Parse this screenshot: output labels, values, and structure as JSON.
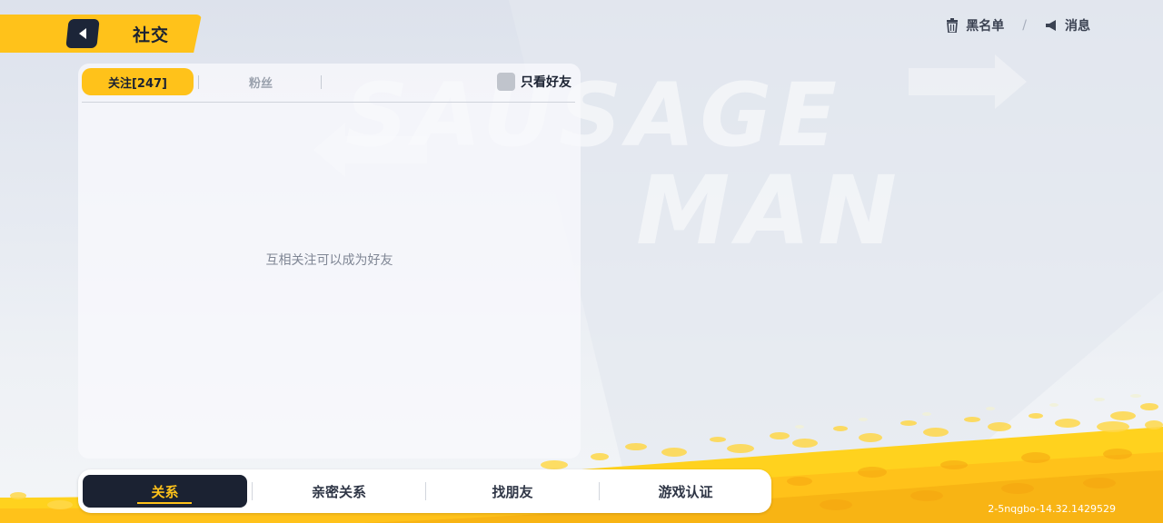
{
  "header": {
    "title": "社交",
    "blacklist_label": "黑名单",
    "separator": "/",
    "messages_label": "消息"
  },
  "tabs": {
    "follow_label": "关注[247]",
    "fans_label": "粉丝",
    "friends_only_label": "只看好友",
    "friends_only_checked": false
  },
  "panel": {
    "empty_message": "互相关注可以成为好友"
  },
  "bottom_nav": {
    "items": [
      {
        "label": "关系",
        "active": true
      },
      {
        "label": "亲密关系",
        "active": false
      },
      {
        "label": "找朋友",
        "active": false
      },
      {
        "label": "游戏认证",
        "active": false
      }
    ]
  },
  "background": {
    "logo_line1": "SAUSAGE",
    "logo_line2": "MAN"
  },
  "footer": {
    "version": "2-5nqgbo-14.32.1429529"
  },
  "colors": {
    "accent": "#ffc21a",
    "dark": "#1b2232"
  }
}
